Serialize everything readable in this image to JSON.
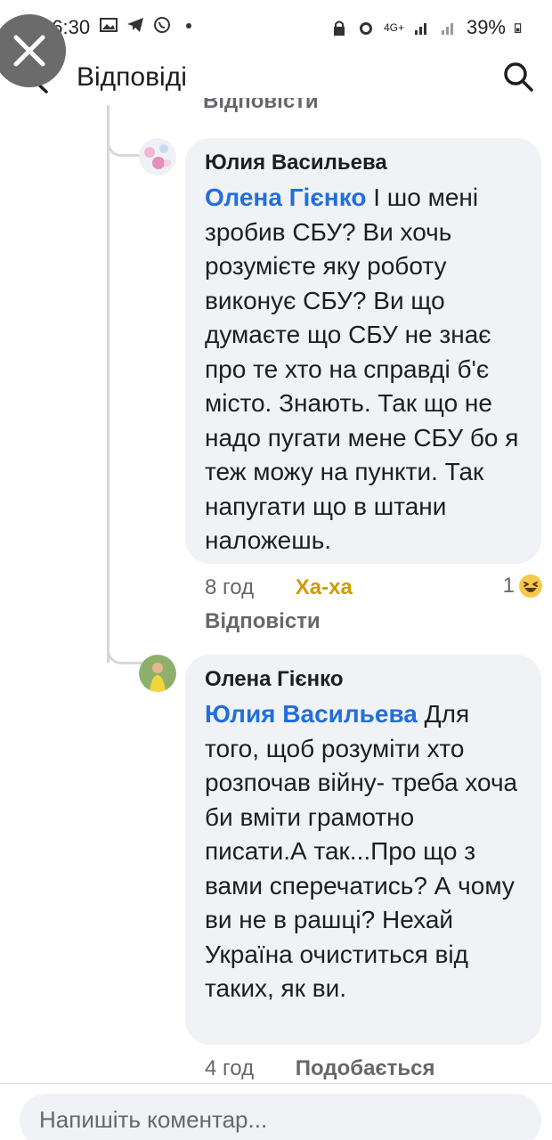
{
  "status_bar": {
    "time": "16:30",
    "network": "4G+",
    "battery": "39%"
  },
  "header": {
    "title": "Відповіді"
  },
  "clipped_reply_label": "Відповісти",
  "comments": [
    {
      "author": "Юлия Васильева",
      "mention": "Олена Гієнко",
      "text": " І шо мені зробив СБУ? Ви хочь розумієте яку роботу виконує СБУ? Ви що думаєте що СБУ не знає про те хто на справді б'є місто. Знають. Так що не надо пугати мене СБУ бо я теж можу на пункти. Так напугати що в штани наложешь.",
      "time": "8 год",
      "reaction_label": "Ха-ха",
      "reaction_count": "1",
      "reaction_icon": "laughing-emoji-icon",
      "reply_label": "Відповісти"
    },
    {
      "author": "Олена Гієнко",
      "mention": "Юлия Васильева",
      "text": " Для того, щоб розуміти хто розпочав війну- треба хоча би вміти грамотно писати.А так...Про що з вами сперечатись? А чому ви не в рашці? Нехай Україна очиститься від таких, як ви.",
      "time": "4 год",
      "reaction_label": "Подобається"
    }
  ],
  "composer": {
    "placeholder": "Напишіть коментар..."
  },
  "colors": {
    "mention": "#216fdb",
    "haha": "#cf9a08",
    "bubble": "#f0f2f5"
  }
}
